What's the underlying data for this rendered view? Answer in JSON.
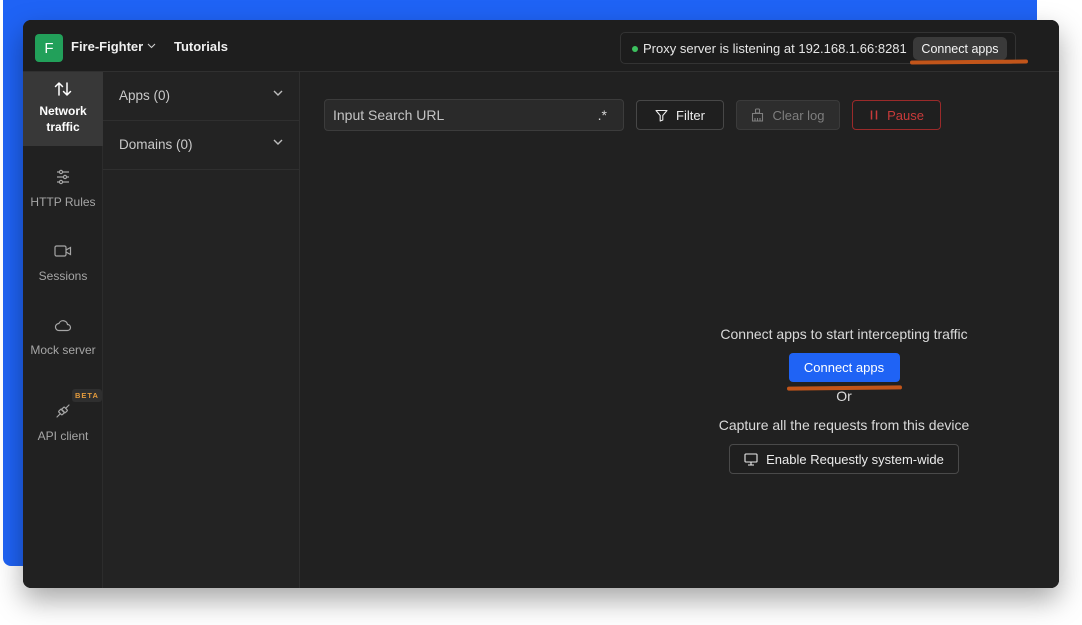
{
  "colors": {
    "brand_blue": "#1f63f5",
    "workspace_green": "#22a05a",
    "status_green": "#3cc05e",
    "pause_red": "#c83a3a",
    "beta_orange": "#e49b3c",
    "annotation_underline": "#c2551a"
  },
  "header": {
    "workspace_initial": "F",
    "workspace_name": "Fire-Fighter",
    "workspace_chevron": "⌵",
    "tutorials_label": "Tutorials",
    "proxy_status": "Proxy server is listening at 192.168.1.66:8281",
    "connect_apps_label": "Connect apps"
  },
  "sidebar": {
    "items": [
      {
        "label_line1": "Network",
        "label_line2": "traffic",
        "icon": "arrows-up-down-icon",
        "active": true
      },
      {
        "label": "HTTP Rules",
        "icon": "sliders-icon"
      },
      {
        "label": "Sessions",
        "icon": "video-camera-icon"
      },
      {
        "label": "Mock server",
        "icon": "cloud-icon"
      },
      {
        "label": "API client",
        "icon": "plug-icon",
        "badge": "BETA"
      }
    ]
  },
  "filters": {
    "apps_label": "Apps (0)",
    "domains_label": "Domains (0)"
  },
  "toolbar": {
    "search_placeholder": "Input Search URL",
    "regex_toggle": ".*",
    "filter_label": "Filter",
    "clear_log_label": "Clear log",
    "pause_label": "Pause"
  },
  "empty_state": {
    "message": "Connect apps to start intercepting traffic",
    "connect_apps_label": "Connect apps",
    "or_label": "Or",
    "capture_message": "Capture all the requests from this device",
    "system_wide_label": "Enable Requestly system-wide"
  }
}
